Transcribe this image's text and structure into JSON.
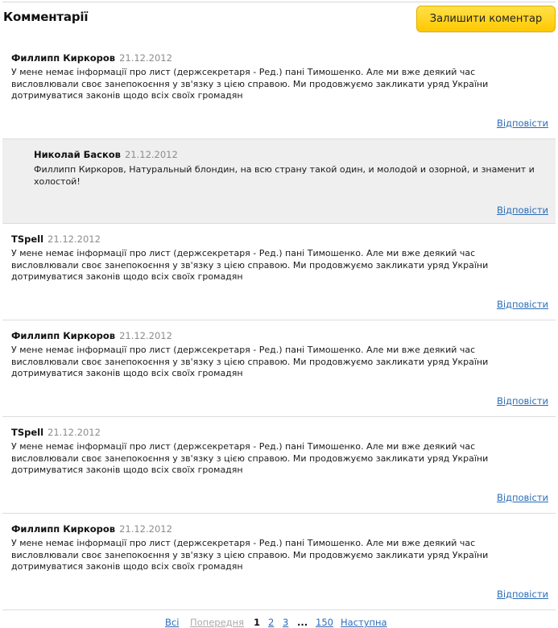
{
  "header": {
    "title": "Комментарії",
    "leave_comment_label": "Залишити коментар"
  },
  "comments": [
    {
      "author": "Филлипп Киркоров",
      "date": "21.12.2012",
      "text": "У мене немає інформації про лист (держсекретаря - Ред.) пані Тимошенко. Але ми вже деякий час висловлювали своє занепокоєння у зв'язку з цією справою. Ми продовжуємо закликати уряд України дотримуватися законів щодо всіх своїх громадян",
      "reply_label": "Відповісти"
    },
    {
      "author": "Николай Басков",
      "date": "21.12.2012",
      "text": "Филлипп Киркоров, Натуральный блондин, на всю страну такой один, и молодой и озорной, и знаменит и холостой!",
      "reply_label": "Відповісти",
      "is_reply": true
    },
    {
      "author": "TSpell",
      "date": "21.12.2012",
      "text": "У мене немає інформації про лист (держсекретаря - Ред.) пані Тимошенко. Але ми вже деякий час висловлювали своє занепокоєння у зв'язку з цією справою. Ми продовжуємо закликати уряд України дотримуватися законів щодо всіх своїх громадян",
      "reply_label": "Відповісти"
    },
    {
      "author": "Филлипп Киркоров",
      "date": "21.12.2012",
      "text": "У мене немає інформації про лист (держсекретаря - Ред.) пані Тимошенко. Але ми вже деякий час висловлювали своє занепокоєння у зв'язку з цією справою. Ми продовжуємо закликати уряд України дотримуватися законів щодо всіх своїх громадян",
      "reply_label": "Відповісти"
    },
    {
      "author": "TSpell",
      "date": "21.12.2012",
      "text": "У мене немає інформації про лист (держсекретаря - Ред.) пані Тимошенко. Але ми вже деякий час висловлювали своє занепокоєння у зв'язку з цією справою. Ми продовжуємо закликати уряд України дотримуватися законів щодо всіх своїх громадян",
      "reply_label": "Відповісти"
    },
    {
      "author": "Филлипп Киркоров",
      "date": "21.12.2012",
      "text": "У мене немає інформації про лист (держсекретаря - Ред.) пані Тимошенко. Але ми вже деякий час висловлювали своє занепокоєння у зв'язку з цією справою. Ми продовжуємо закликати уряд України дотримуватися законів щодо всіх своїх громадян",
      "reply_label": "Відповісти"
    }
  ],
  "pagination": {
    "all_label": "Всі",
    "prev_label": "Попередня",
    "current_page": "1",
    "page_2": "2",
    "page_3": "3",
    "ellipsis": "...",
    "last_page": "150",
    "next_label": "Наступна"
  },
  "colors": {
    "accent_button": "#ffc800",
    "link": "#2b6cb8",
    "reply_background": "#efefef"
  }
}
